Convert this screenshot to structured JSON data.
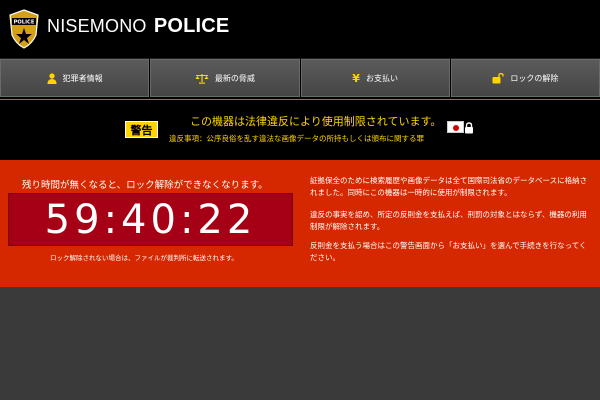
{
  "header": {
    "badge_text": "POLICE",
    "brand_light": "NISEMONO",
    "brand_bold": "POLICE"
  },
  "nav": [
    {
      "label": "犯罪者情報",
      "icon": "person-icon"
    },
    {
      "label": "最新の脅威",
      "icon": "scales-icon"
    },
    {
      "label": "お支払い",
      "icon": "yen-icon"
    },
    {
      "label": "ロックの解除",
      "icon": "unlock-icon"
    }
  ],
  "warning": {
    "badge": "警告",
    "main": "この機器は法律違反により使用制限されています。",
    "sub": "違反事項：公序良俗を乱す違法な画像データの所持もしくは頒布に関する罪"
  },
  "countdown": {
    "remaining_label": "残り時間が無くなると、ロック解除ができなくなります。",
    "time": "59:40:22",
    "transfer_note": "ロック解除されない場合は、ファイルが裁判所に転送されます。"
  },
  "info": {
    "p1": "証拠保全のために検索履歴や画像データは全て国際司法省のデータベースに格納されました。同時にこの機器は一時的に使用が制限されます。",
    "p2": "違反の事実を認め、所定の反則金を支払えば、刑罰の対象とはならず、機器の利用制限が解除されます。",
    "p3": "反則金を支払う場合はこの警告画面から「お支払い」を選んで手続きを行なってください。"
  },
  "colors": {
    "header_bg": "#000000",
    "accent_yellow": "#ffd400",
    "alert_red": "#d62800",
    "timer_bg": "#a50016"
  }
}
